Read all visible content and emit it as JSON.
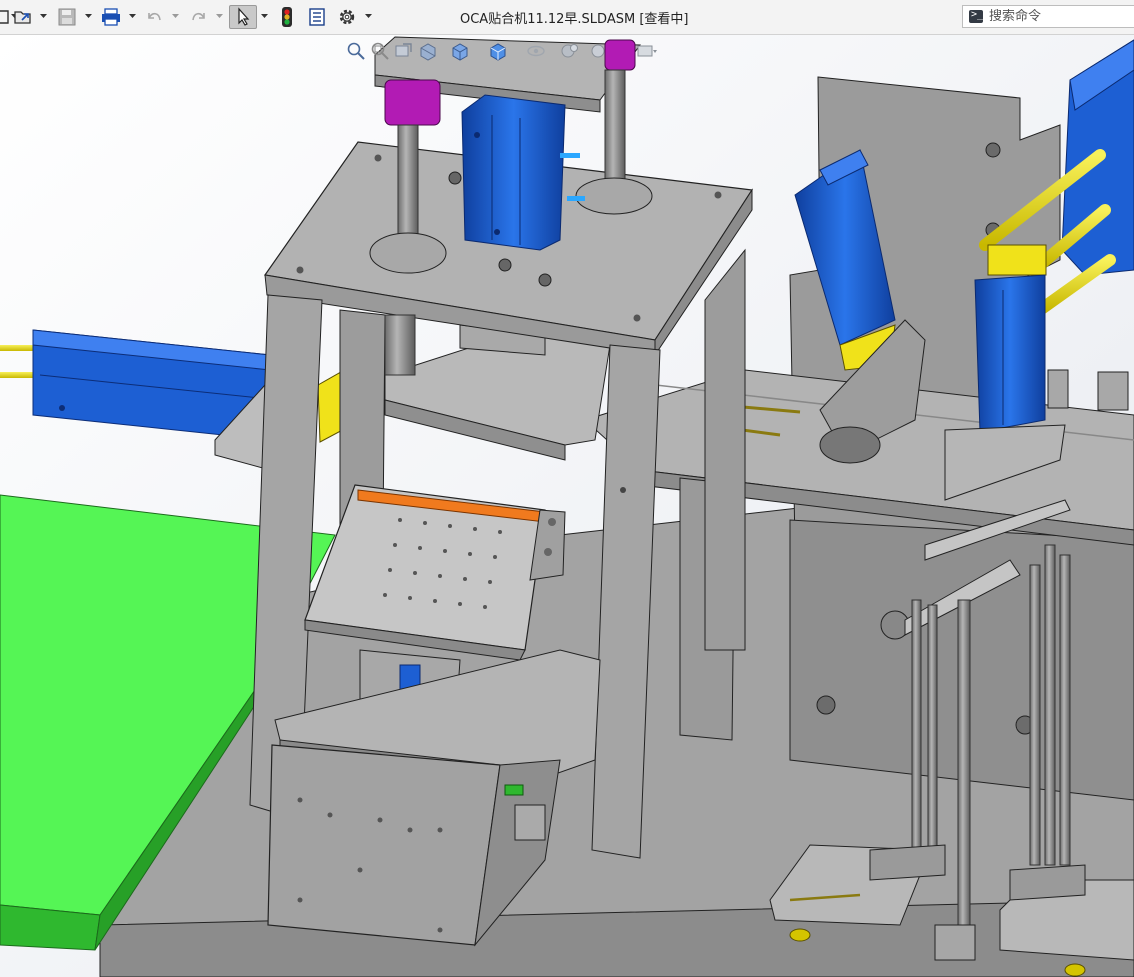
{
  "window": {
    "title": "OCA贴合机11.12早.SLDASM [查看中]"
  },
  "toolbar": {
    "items": [
      {
        "name": "new-icon"
      },
      {
        "name": "open-icon"
      },
      {
        "name": "save-icon"
      },
      {
        "name": "print-icon"
      },
      {
        "name": "undo-icon"
      },
      {
        "name": "redo-icon"
      },
      {
        "name": "select-icon",
        "active": true
      },
      {
        "name": "traffic-light-icon"
      },
      {
        "name": "file-properties-icon"
      },
      {
        "name": "options-gear-icon"
      }
    ]
  },
  "search": {
    "placeholder": "搜索命令",
    "value": ""
  },
  "view_hud": {
    "items": [
      "zoom-to-fit-icon",
      "zoom-area-icon",
      "previous-view-icon",
      "section-view-icon",
      "view-orientation-icon",
      "display-style-icon",
      "hide-show-items-icon",
      "edit-appearance-icon",
      "apply-scene-icon",
      "view-settings-icon"
    ]
  },
  "colors": {
    "floor_green": "#55f555",
    "plate_gray": "#a9a9a9",
    "cylinder_blue": "#1b5fd6",
    "accent_orange": "#f07a1e",
    "accent_yellow": "#f0e21a",
    "accent_magenta": "#b21bb4",
    "background": "#ffffff"
  }
}
